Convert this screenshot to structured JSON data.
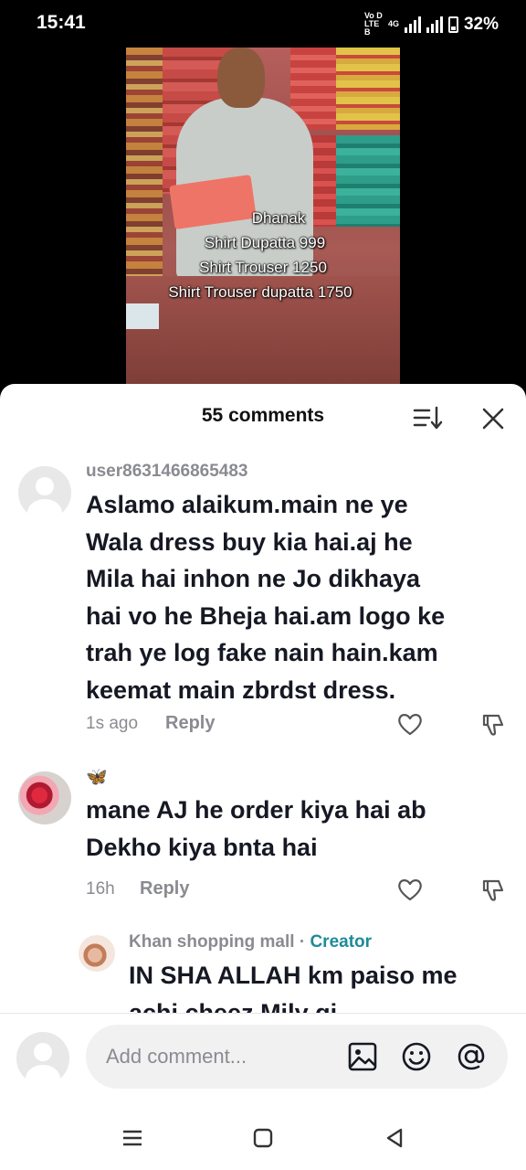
{
  "status_bar": {
    "time": "15:41",
    "volte_line1": "Vo D",
    "volte_line2": "LTE B",
    "network": "4G",
    "battery": "32%"
  },
  "video": {
    "overlay_lines": [
      "Dhanak",
      "Shirt Dupatta 999",
      "Shirt Trouser 1250",
      "Shirt Trouser dupatta 1750"
    ]
  },
  "comments_sheet": {
    "title": "55 comments",
    "sort_icon": "sort-icon",
    "close_icon": "close-icon",
    "comments": [
      {
        "username": "user8631466865483",
        "lines": [
          "Aslamo alaikum.main ne ye",
          "Wala dress buy kia hai.aj he",
          "Mila hai inhon ne Jo dikhaya",
          "hai vo he Bheja hai.am logo ke",
          "trah ye log fake nain hain.kam",
          "keemat main zbrdst dress."
        ],
        "time": "1s ago",
        "reply_label": "Reply"
      },
      {
        "username": "🦋",
        "lines": [
          "mane AJ he order kiya hai ab",
          "Dekho kiya bnta hai"
        ],
        "time": "16h",
        "reply_label": "Reply"
      },
      {
        "username": "Khan shopping mall",
        "separator": " · ",
        "creator_tag": "Creator",
        "lines": [
          "IN SHA ALLAH km paiso me",
          "achi cheez Mily gi"
        ]
      }
    ]
  },
  "composer": {
    "placeholder": "Add comment...",
    "icons": [
      "image-icon",
      "emoji-icon",
      "mention-icon"
    ]
  },
  "navbar": {
    "icons": [
      "menu-icon",
      "home-icon",
      "back-icon"
    ]
  }
}
